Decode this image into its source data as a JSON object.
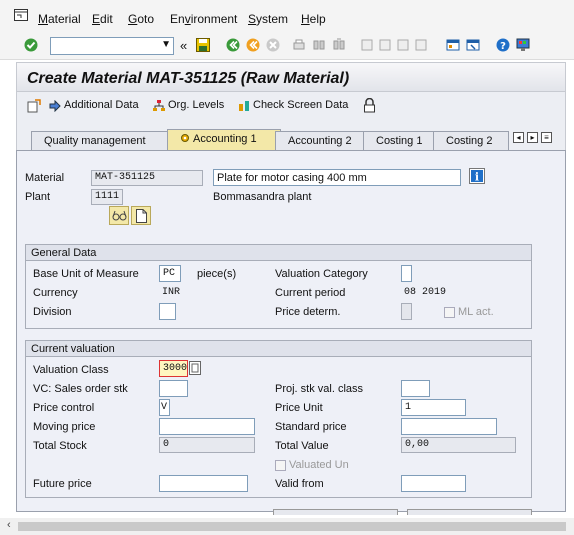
{
  "menu": {
    "items": [
      "Material",
      "Edit",
      "Goto",
      "Environment",
      "System",
      "Help"
    ]
  },
  "toolbar": {
    "command_value": "",
    "back_symbol": "«"
  },
  "screen": {
    "title": "Create Material MAT-351125 (Raw Material)"
  },
  "app_toolbar": {
    "additional_data": "Additional Data",
    "org_levels": "Org. Levels",
    "check_screen_data": "Check Screen Data"
  },
  "tabs": [
    {
      "label": "Quality management",
      "active": false
    },
    {
      "label": "Accounting 1",
      "active": true
    },
    {
      "label": "Accounting 2",
      "active": false
    },
    {
      "label": "Costing 1",
      "active": false
    },
    {
      "label": "Costing 2",
      "active": false
    }
  ],
  "header": {
    "material_label": "Material",
    "material_value": "MAT-351125",
    "description": "Plate for motor casing 400 mm",
    "plant_label": "Plant",
    "plant_value": "1111",
    "plant_name": "Bommasandra plant"
  },
  "general_data": {
    "title": "General Data",
    "base_uom_label": "Base Unit of Measure",
    "base_uom_value": "PC",
    "base_uom_text": "piece(s)",
    "valuation_category_label": "Valuation Category",
    "valuation_category_value": "",
    "currency_label": "Currency",
    "currency_value": "INR",
    "current_period_label": "Current period",
    "current_period_value": "08 2019",
    "division_label": "Division",
    "division_value": "",
    "price_determ_label": "Price determ.",
    "ml_act_label": "ML act."
  },
  "current_valuation": {
    "title": "Current valuation",
    "valuation_class_label": "Valuation Class",
    "valuation_class_value": "3000",
    "vc_sales_label": "VC: Sales order stk",
    "vc_sales_value": "",
    "proj_stk_label": "Proj. stk val. class",
    "proj_stk_value": "",
    "price_control_label": "Price control",
    "price_control_value": "V",
    "price_unit_label": "Price Unit",
    "price_unit_value": "1",
    "moving_price_label": "Moving price",
    "moving_price_value": "",
    "standard_price_label": "Standard price",
    "standard_price_value": "",
    "total_stock_label": "Total Stock",
    "total_stock_value": "0",
    "total_value_label": "Total Value",
    "total_value_value": "0,00",
    "valuated_un_label": "Valuated Un",
    "future_price_label": "Future price",
    "future_price_value": "",
    "valid_from_label": "Valid from",
    "valid_from_value": ""
  },
  "colors": {
    "active_tab": "#f3e8a8",
    "content_bg": "#eef0f7"
  }
}
